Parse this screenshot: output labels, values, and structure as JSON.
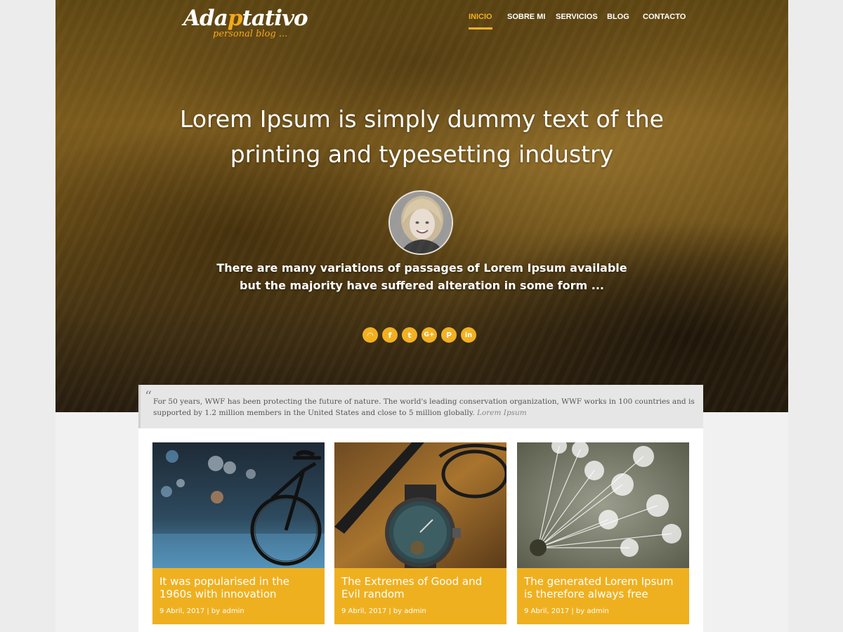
{
  "brand": {
    "logo_prefix": "Ada",
    "logo_accent": "p",
    "logo_suffix": "tativo",
    "tagline": "personal blog ...",
    "accent_color": "#f2b01f"
  },
  "nav": {
    "items": [
      {
        "label": "INICIO",
        "active": true
      },
      {
        "label": "SOBRE MI",
        "active": false
      },
      {
        "label": "SERVICIOS",
        "active": false
      },
      {
        "label": "BLOG",
        "active": false
      },
      {
        "label": "CONTACTO",
        "active": false
      }
    ]
  },
  "hero": {
    "title": "Lorem Ipsum is simply dummy text of the printing and typesetting industry",
    "subtitle": "There are many variations of passages of Lorem Ipsum available but the majority have suffered alteration in some form ...",
    "avatar_icon": "woman-portrait"
  },
  "social": {
    "items": [
      {
        "icon": "rss-icon",
        "glyph": "◠"
      },
      {
        "icon": "facebook-icon",
        "glyph": "f"
      },
      {
        "icon": "twitter-icon",
        "glyph": "t"
      },
      {
        "icon": "google-plus-icon",
        "glyph": "G+"
      },
      {
        "icon": "pinterest-icon",
        "glyph": "P"
      },
      {
        "icon": "linkedin-icon",
        "glyph": "in"
      }
    ]
  },
  "quote": {
    "mark": "“",
    "text": "For 50 years, WWF has been protecting the future of nature. The world's leading conservation organization, WWF works in 100 countries and is supported by 1.2 million members in the United States and close to 5 million globally.",
    "cite": "Lorem Ipsum"
  },
  "posts": [
    {
      "title": "It was popularised in the 1960s with innovation",
      "meta": "9 Abril, 2017 | by admin",
      "image": "bicycle-night-street"
    },
    {
      "title": "The Extremes of Good and Evil random",
      "meta": "9 Abril, 2017 | by admin",
      "image": "watch-pen-glasses"
    },
    {
      "title": "The generated Lorem Ipsum is therefore always free",
      "meta": "9 Abril, 2017 | by admin",
      "image": "dandelion-seeds"
    }
  ]
}
